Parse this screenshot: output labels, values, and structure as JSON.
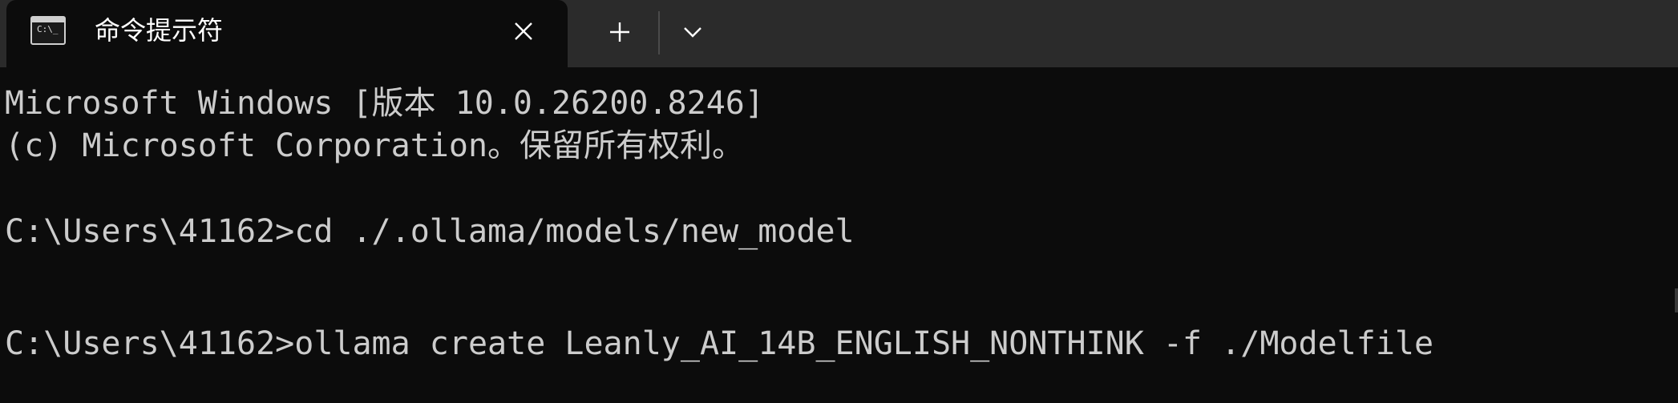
{
  "tab": {
    "title": "命令提示符",
    "icon_label": "C:\\_",
    "icon": "terminal-icon",
    "close_icon": "close-icon"
  },
  "toolbar": {
    "new_tab_icon": "plus-icon",
    "dropdown_icon": "chevron-down-icon"
  },
  "console": {
    "lines": [
      "Microsoft Windows [版本 10.0.26200.8246]",
      "(c) Microsoft Corporation。保留所有权利。",
      "C:\\Users\\41162>cd ./.ollama/models/new_model",
      "C:\\Users\\41162>ollama create Leanly_AI_14B_ENGLISH_NONTHINK -f ./Modelfile"
    ]
  },
  "colors": {
    "titlebar": "#2b2b2b",
    "background": "#0c0c0c",
    "text": "#cccccc"
  }
}
